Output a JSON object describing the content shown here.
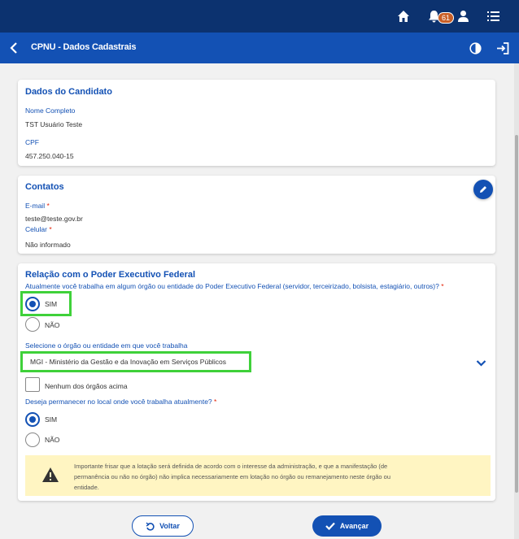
{
  "topbar": {
    "notifications_count": "61",
    "icons": [
      "home-icon",
      "bell-icon",
      "user-icon",
      "menu-icon"
    ]
  },
  "appbar": {
    "title": "CPNU - Dados Cadastrais",
    "icons": [
      "back-arrow-icon",
      "contrast-icon",
      "logout-icon"
    ]
  },
  "candidate": {
    "title": "Dados do Candidato",
    "name_label": "Nome Completo",
    "name_value": "TST Usuário Teste",
    "cpf_label": "CPF",
    "cpf_value": "457.250.040-15"
  },
  "contacts": {
    "title": "Contatos",
    "email_label": "E-mail",
    "email_value": "teste@teste.gov.br",
    "phone_label": "Celular",
    "phone_value": "Não informado",
    "required_mark": "*"
  },
  "relation": {
    "title": "Relação com o Poder Executivo Federal",
    "question1": "Atualmente você trabalha em algum órgão ou entidade do Poder Executivo Federal (servidor, terceirizado, bolsista, estagiário, outros)?",
    "q1_options": [
      "SIM",
      "NÃO"
    ],
    "q1_selected": "SIM",
    "select_label": "Selecione o órgão ou entidade em que você trabalha",
    "select_value": "MGI - Ministério da Gestão e da Inovação em Serviços Públicos",
    "none_option": "Nenhum dos órgãos acima",
    "question2": "Deseja permanecer no local onde você trabalha atualmente?",
    "q2_options": [
      "SIM",
      "NÃO"
    ],
    "q2_selected": "SIM",
    "warning": "Importante frisar que a lotação será definida de acordo com o interesse da administração, e que a manifestação (de permanência ou não no órgão) não implica necessariamente em lotação no órgão ou remanejamento neste órgão ou entidade."
  },
  "actions": {
    "back_label": "Voltar",
    "next_label": "Avançar"
  },
  "colors": {
    "primary": "#1351b4",
    "header": "#0c326f",
    "highlight": "#3fd13a",
    "warning_bg": "#fff5c2",
    "badge": "#c95f27"
  }
}
